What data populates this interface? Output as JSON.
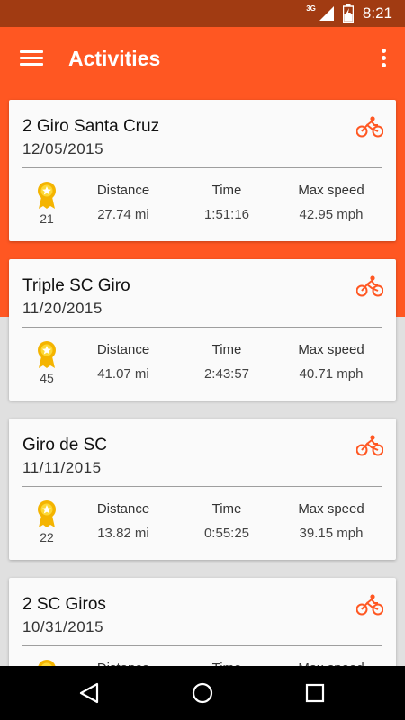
{
  "status_bar": {
    "network": "3G",
    "time": "8:21"
  },
  "app_bar": {
    "title": "Activities",
    "menu_icon": "hamburger-menu-icon",
    "overflow_icon": "more-vert-icon"
  },
  "labels": {
    "distance": "Distance",
    "time": "Time",
    "max_speed": "Max speed"
  },
  "colors": {
    "accent": "#ff5722",
    "status_bar": "#a13b12"
  },
  "activities": [
    {
      "name": "2 Giro Santa Cruz",
      "date": "12/05/2015",
      "awards": "21",
      "distance": "27.74 mi",
      "time": "1:51:16",
      "max_speed": "42.95 mph",
      "type_icon": "bike-icon"
    },
    {
      "name": "Triple SC Giro",
      "date": "11/20/2015",
      "awards": "45",
      "distance": "41.07 mi",
      "time": "2:43:57",
      "max_speed": "40.71 mph",
      "type_icon": "bike-icon"
    },
    {
      "name": "Giro de SC",
      "date": "11/11/2015",
      "awards": "22",
      "distance": "13.82 mi",
      "time": "0:55:25",
      "max_speed": "39.15 mph",
      "type_icon": "bike-icon"
    },
    {
      "name": "2 SC Giros",
      "date": "10/31/2015",
      "awards": "",
      "distance": "",
      "time": "",
      "max_speed": "",
      "type_icon": "bike-icon"
    }
  ],
  "partial_labels": {
    "distance": "Distance",
    "time": "Time",
    "max_speed": "Max speed"
  },
  "nav": {
    "back": "back-icon",
    "home": "home-icon",
    "recents": "recents-icon"
  }
}
